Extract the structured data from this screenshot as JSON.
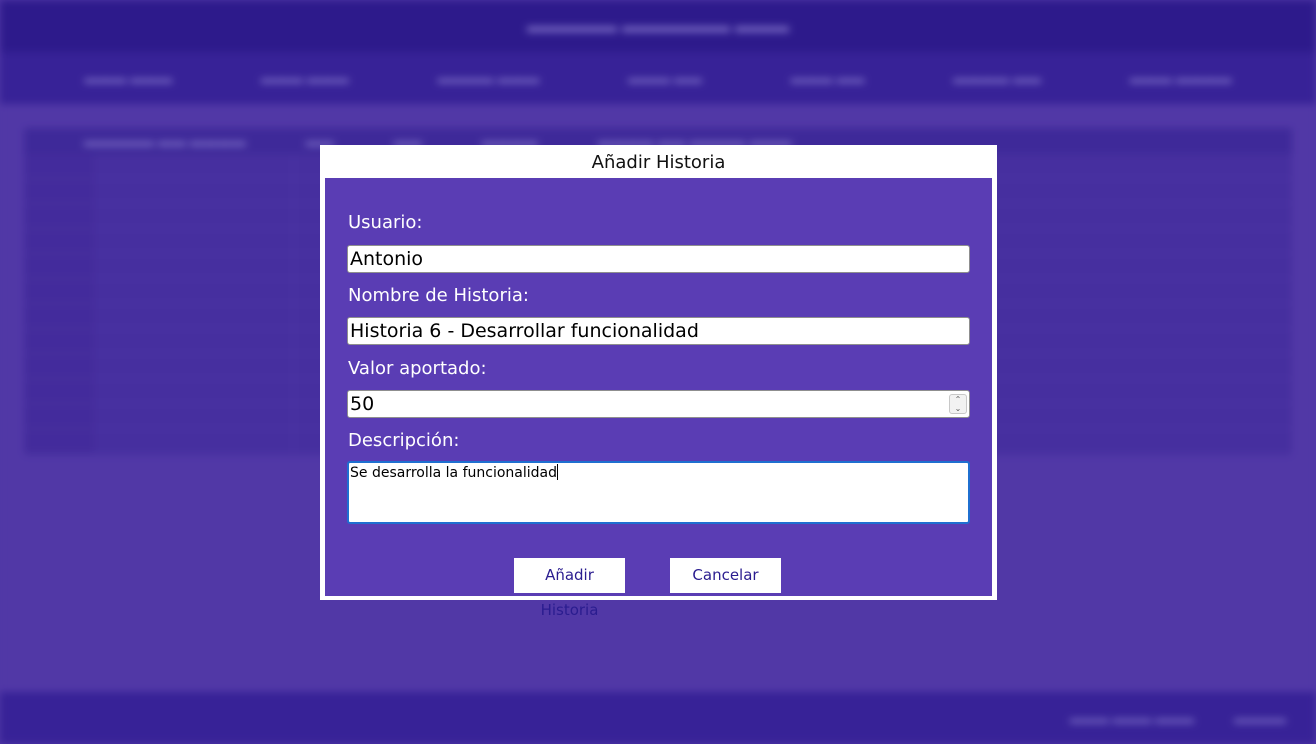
{
  "modal": {
    "title": "Añadir Historia",
    "fields": {
      "usuario_label": "Usuario:",
      "usuario_value": "Antonio",
      "nombre_label": "Nombre de Historia:",
      "nombre_value": "Historia 6 - Desarrollar funcionalidad",
      "valor_label": "Valor aportado:",
      "valor_value": "50",
      "descripcion_label": "Descripción:",
      "descripcion_value": "Se desarrolla la funcionalidad"
    },
    "buttons": {
      "add_label": "Añadir Historia",
      "cancel_label": "Cancelar"
    }
  },
  "colors": {
    "background": "#5b40b3",
    "modal_body": "#5a3db4",
    "button_text": "#2a1c8f",
    "focus_border": "#1f6fd0"
  },
  "icons": {
    "stepper": "spin-arrows-icon"
  }
}
